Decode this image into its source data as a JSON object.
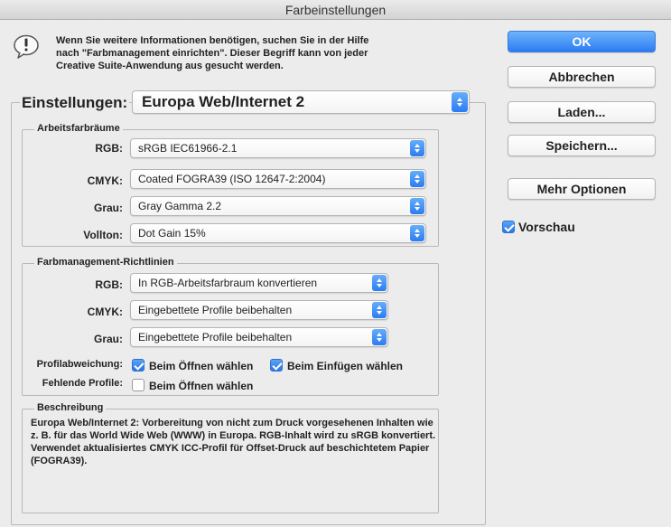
{
  "window": {
    "title": "Farbeinstellungen"
  },
  "warning": {
    "icon": "exclamation-bubble-icon",
    "text": "Wenn Sie weitere Informationen benötigen, suchen Sie in der Hilfe nach \"Farbmanagement einrichten\". Dieser Begriff kann von jeder Creative Suite-Anwendung aus gesucht werden."
  },
  "buttons": {
    "ok": "OK",
    "cancel": "Abbrechen",
    "load": "Laden...",
    "save": "Speichern...",
    "more": "Mehr Optionen"
  },
  "preview": {
    "label": "Vorschau",
    "checked": true
  },
  "settings": {
    "label": "Einstellungen:",
    "value": "Europa Web/Internet 2"
  },
  "working_spaces": {
    "title": "Arbeitsfarbräume",
    "rows": [
      {
        "label": "RGB:",
        "value": "sRGB IEC61966-2.1"
      },
      {
        "label": "CMYK:",
        "value": "Coated FOGRA39 (ISO 12647-2:2004)"
      },
      {
        "label": "Grau:",
        "value": "Gray Gamma 2.2"
      },
      {
        "label": "Vollton:",
        "value": "Dot Gain 15%"
      }
    ]
  },
  "policies": {
    "title": "Farbmanagement-Richtlinien",
    "rows": [
      {
        "label": "RGB:",
        "value": "In RGB-Arbeitsfarbraum konvertieren"
      },
      {
        "label": "CMYK:",
        "value": "Eingebettete Profile beibehalten"
      },
      {
        "label": "Grau:",
        "value": "Eingebettete Profile beibehalten"
      }
    ],
    "mismatch": {
      "label": "Profilabweichung:",
      "open": {
        "label": "Beim Öffnen wählen",
        "checked": true
      },
      "paste": {
        "label": "Beim Einfügen wählen",
        "checked": true
      }
    },
    "missing": {
      "label": "Fehlende Profile:",
      "open": {
        "label": "Beim Öffnen wählen",
        "checked": false
      }
    }
  },
  "description": {
    "title": "Beschreibung",
    "text": "Europa Web/Internet 2:  Vorbereitung von nicht zum Druck vorgesehenen Inhalten wie z. B. für das World Wide Web (WWW) in Europa. RGB-Inhalt wird zu sRGB konvertiert. Verwendet aktualisiertes CMYK ICC-Profil für Offset-Druck auf beschichtetem Papier (FOGRA39)."
  },
  "colors": {
    "accent": "#2b7cf3",
    "ok_button": "#3d8cf7",
    "background": "#ececec"
  }
}
